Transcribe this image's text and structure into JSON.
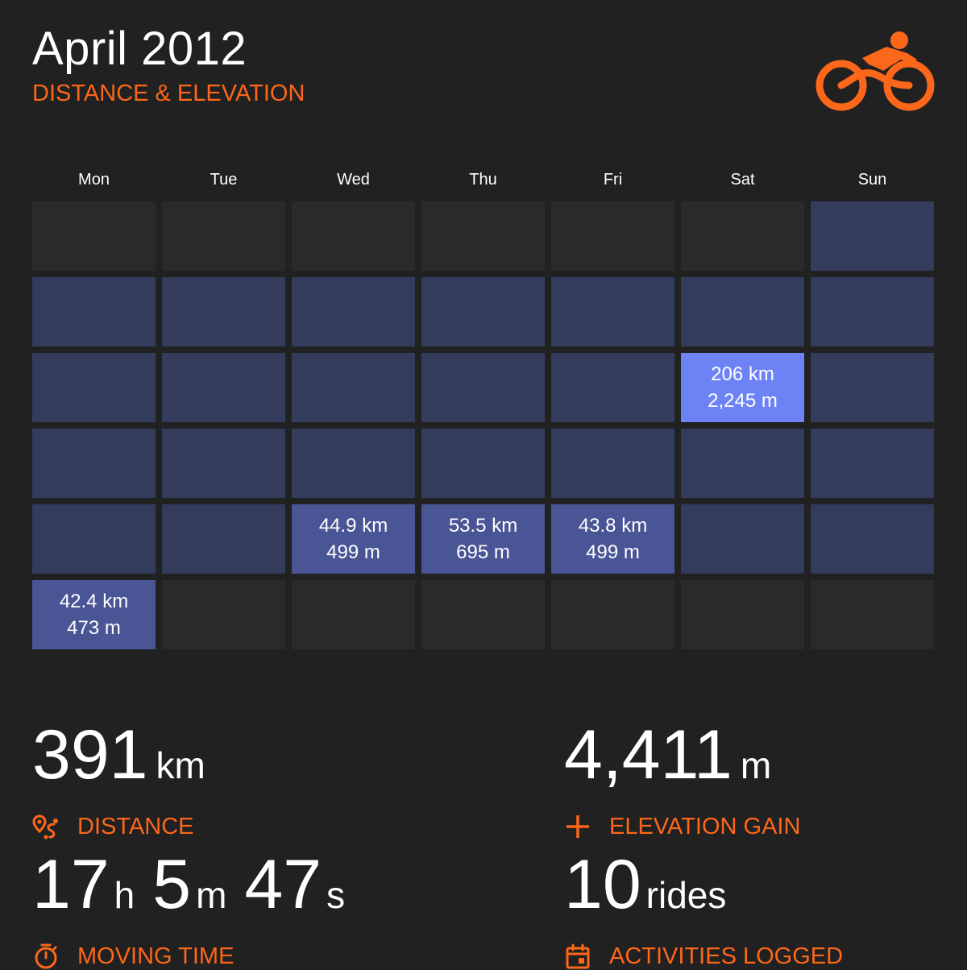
{
  "header": {
    "title": "April 2012",
    "subtitle": "DISTANCE & ELEVATION",
    "logo_icon": "cyclist-icon"
  },
  "colors": {
    "accent": "#fc6719",
    "background": "#212121",
    "empty_cell": "#2a2a2a",
    "day_cell": "#343c5c",
    "ride_cell": "#4a5596",
    "max_ride_cell": "#6d83f5"
  },
  "calendar": {
    "weekdays": [
      "Mon",
      "Tue",
      "Wed",
      "Thu",
      "Fri",
      "Sat",
      "Sun"
    ],
    "weeks": [
      [
        {
          "kind": "empty"
        },
        {
          "kind": "empty"
        },
        {
          "kind": "empty"
        },
        {
          "kind": "empty"
        },
        {
          "kind": "empty"
        },
        {
          "kind": "empty"
        },
        {
          "kind": "day"
        }
      ],
      [
        {
          "kind": "day"
        },
        {
          "kind": "day"
        },
        {
          "kind": "day"
        },
        {
          "kind": "day"
        },
        {
          "kind": "day"
        },
        {
          "kind": "day"
        },
        {
          "kind": "day"
        }
      ],
      [
        {
          "kind": "day"
        },
        {
          "kind": "day"
        },
        {
          "kind": "day"
        },
        {
          "kind": "day"
        },
        {
          "kind": "day"
        },
        {
          "kind": "ride",
          "highlight": true,
          "distance": "206 km",
          "elevation": "2,245 m"
        },
        {
          "kind": "day"
        }
      ],
      [
        {
          "kind": "day"
        },
        {
          "kind": "day"
        },
        {
          "kind": "day"
        },
        {
          "kind": "day"
        },
        {
          "kind": "day"
        },
        {
          "kind": "day"
        },
        {
          "kind": "day"
        }
      ],
      [
        {
          "kind": "day"
        },
        {
          "kind": "day"
        },
        {
          "kind": "ride",
          "distance": "44.9 km",
          "elevation": "499 m"
        },
        {
          "kind": "ride",
          "distance": "53.5 km",
          "elevation": "695 m"
        },
        {
          "kind": "ride",
          "distance": "43.8 km",
          "elevation": "499 m"
        },
        {
          "kind": "day"
        },
        {
          "kind": "day"
        }
      ],
      [
        {
          "kind": "ride",
          "distance": "42.4 km",
          "elevation": "473 m"
        },
        {
          "kind": "empty"
        },
        {
          "kind": "empty"
        },
        {
          "kind": "empty"
        },
        {
          "kind": "empty"
        },
        {
          "kind": "empty"
        },
        {
          "kind": "empty"
        }
      ]
    ]
  },
  "stats": {
    "distance": {
      "value": "391",
      "unit": "km",
      "label": "DISTANCE",
      "icon": "route-icon"
    },
    "elevation": {
      "value": "4,411",
      "unit": "m",
      "label": "ELEVATION GAIN",
      "icon": "plus-icon"
    },
    "moving_time": {
      "hours": "17",
      "hours_unit": "h",
      "minutes": "5",
      "minutes_unit": "m",
      "seconds": "47",
      "seconds_unit": "s",
      "label": "MOVING TIME",
      "icon": "stopwatch-icon"
    },
    "activities": {
      "value": "10",
      "unit": "rides",
      "label": "ACTIVITIES LOGGED",
      "icon": "calendar-icon"
    }
  }
}
